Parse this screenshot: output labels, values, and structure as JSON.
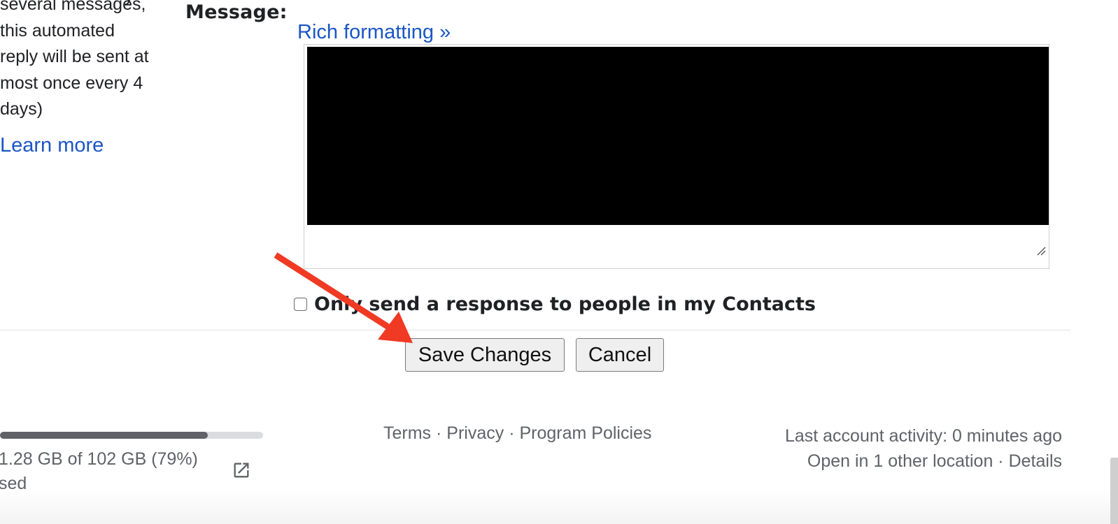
{
  "vacation_responder": {
    "description_partial_top": "y",
    "description_lines": [
      "several messages,",
      "this automated",
      "reply will be sent at",
      "most once every 4",
      "days)"
    ],
    "learn_more_label": "Learn more",
    "message_label": "Message:",
    "rich_formatting_label": "Rich formatting »",
    "message_body": "[redacted]",
    "contacts_only_label": "Only send a response to people in my Contacts",
    "contacts_only_checked": false
  },
  "actions": {
    "save_label": "Save Changes",
    "cancel_label": "Cancel"
  },
  "footer": {
    "storage": {
      "used_fraction": 0.79,
      "text_line1": "1.28 GB of 102 GB (79%)",
      "text_line2": "sed",
      "open_storage_icon": "open-in-new-icon"
    },
    "links": {
      "terms": "Terms",
      "privacy": "Privacy",
      "program_policies": "Program Policies",
      "separator": " · "
    },
    "activity": {
      "last_activity": "Last account activity: 0 minutes ago",
      "open_locations": "Open in 1 other location",
      "separator": " · ",
      "details": "Details"
    }
  },
  "annotation": {
    "type": "arrow",
    "color": "#f03a24",
    "points_to": "save-changes-button"
  },
  "colors": {
    "link": "#1a56c4",
    "muted_text": "#5f6368",
    "storage_fill": "#5f6368",
    "storage_track": "#dadce0"
  }
}
